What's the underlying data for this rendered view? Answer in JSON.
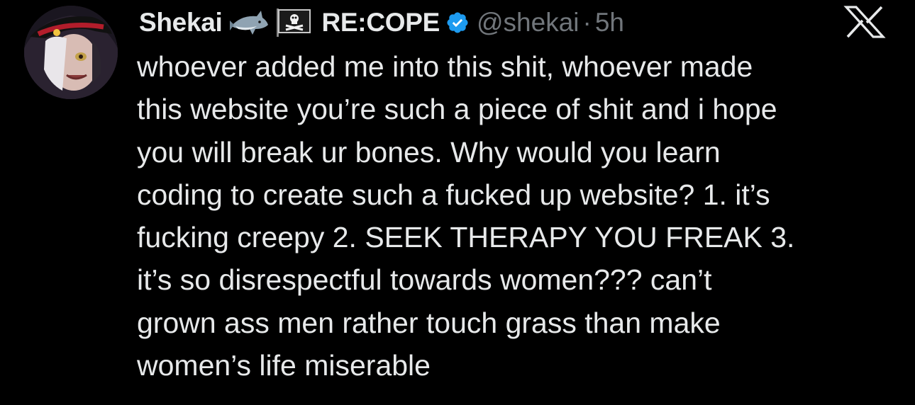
{
  "author": {
    "display_name": "Shekai",
    "name_suffix": "RE:COPE",
    "emojis": [
      "shark-icon",
      "pirate-flag-icon"
    ],
    "verified": true,
    "handle": "@shekai",
    "separator": "·",
    "time": "5h"
  },
  "platform_logo": "x-logo-icon",
  "tweet": {
    "lines": [
      "whoever added me into this shit, whoever made",
      "this website you’re such a piece of shit and i hope",
      "you will break ur bones. Why would you learn",
      "coding to create such a fucked up website? 1. it’s",
      "fucking creepy 2. SEEK THERAPY YOU FREAK 3.",
      "it’s so disrespectful towards women??? can’t",
      "grown ass men rather touch grass than make",
      "women’s life miserable"
    ]
  },
  "colors": {
    "background": "#000000",
    "text": "#e7e9ea",
    "muted": "#71767b",
    "verified": "#1d9bf0"
  }
}
